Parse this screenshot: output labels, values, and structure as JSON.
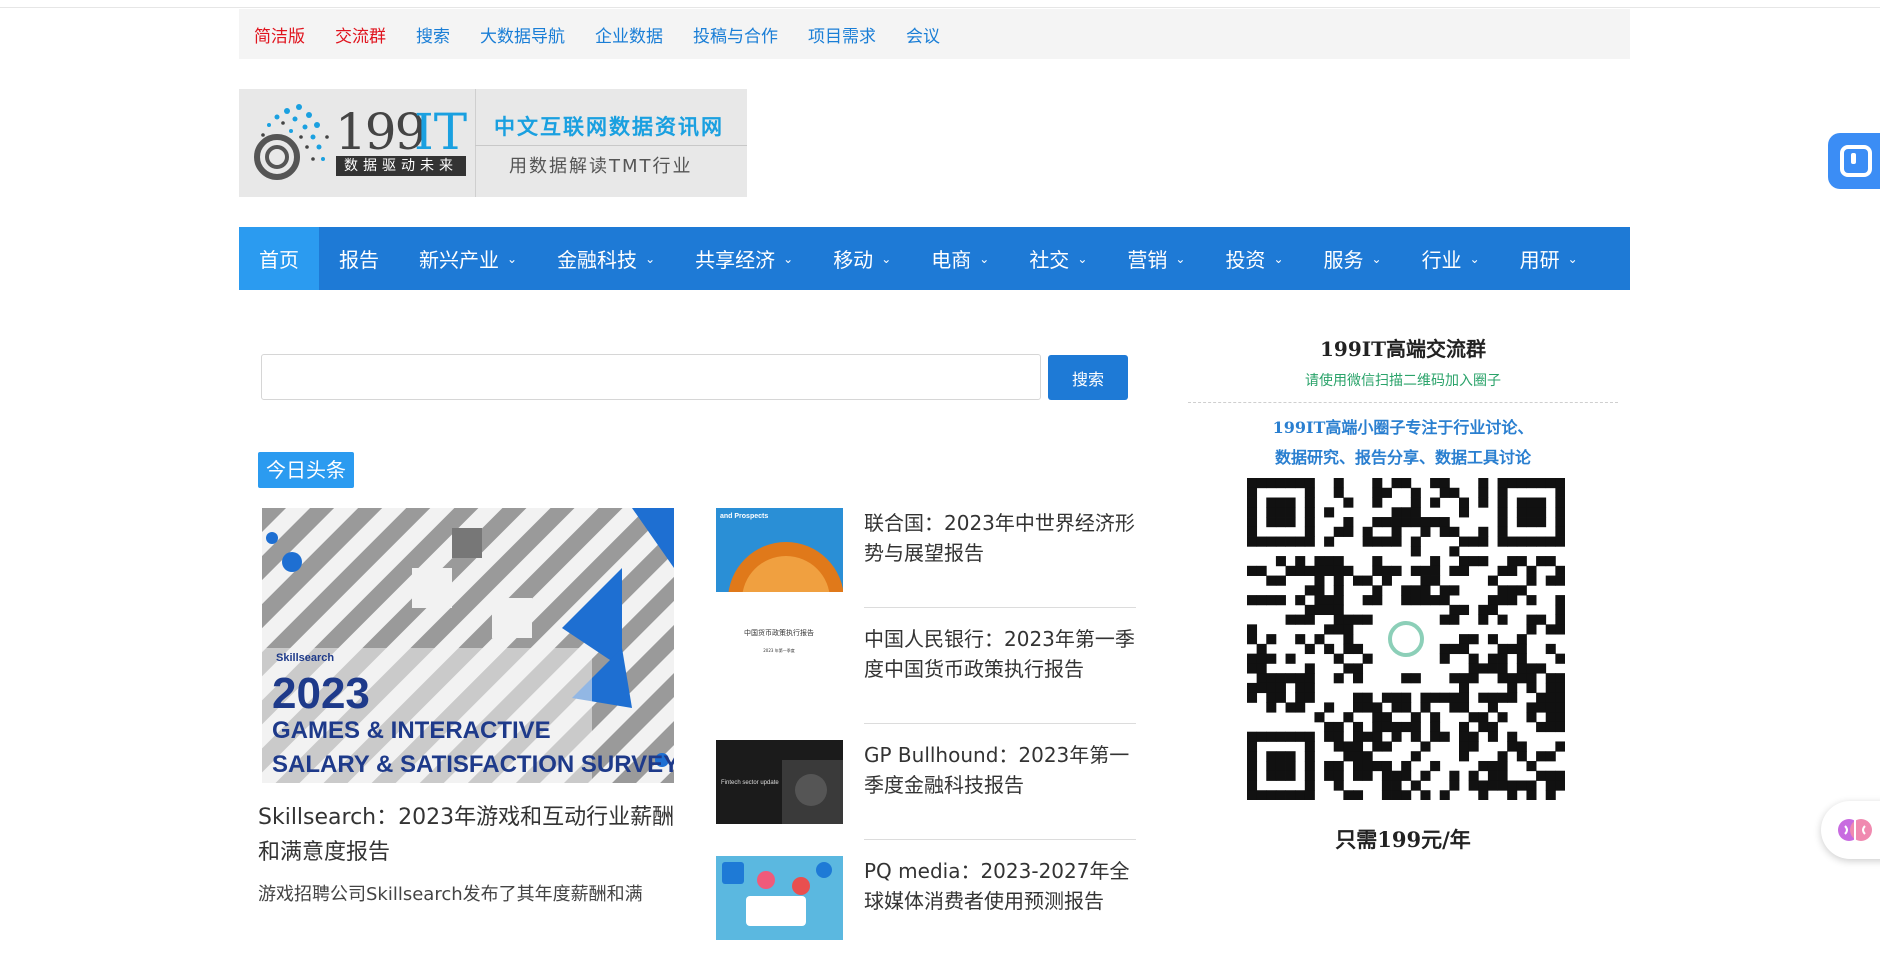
{
  "topbar": {
    "links": [
      {
        "label": "简洁版",
        "color": "#e0141e"
      },
      {
        "label": "交流群",
        "color": "#e0141e"
      },
      {
        "label": "搜索",
        "color": "#1a7ed6"
      },
      {
        "label": "大数据导航",
        "color": "#1a7ed6"
      },
      {
        "label": "企业数据",
        "color": "#1a7ed6"
      },
      {
        "label": "投稿与合作",
        "color": "#1a7ed6"
      },
      {
        "label": "项目需求",
        "color": "#1a7ed6"
      },
      {
        "label": "会议",
        "color": "#1a7ed6"
      }
    ]
  },
  "logo": {
    "number": "199",
    "it": "IT",
    "slogan": "数据驱动未来",
    "tagline": "中文互联网数据资讯网",
    "tagline2": "用数据解读TMT行业"
  },
  "nav": {
    "items": [
      {
        "label": "首页",
        "dropdown": false
      },
      {
        "label": "报告",
        "dropdown": false
      },
      {
        "label": "新兴产业",
        "dropdown": true
      },
      {
        "label": "金融科技",
        "dropdown": true
      },
      {
        "label": "共享经济",
        "dropdown": true
      },
      {
        "label": "移动",
        "dropdown": true
      },
      {
        "label": "电商",
        "dropdown": true
      },
      {
        "label": "社交",
        "dropdown": true
      },
      {
        "label": "营销",
        "dropdown": true
      },
      {
        "label": "投资",
        "dropdown": true
      },
      {
        "label": "服务",
        "dropdown": true
      },
      {
        "label": "行业",
        "dropdown": true
      },
      {
        "label": "用研",
        "dropdown": true
      }
    ],
    "active": "首页",
    "accent": "#1e7ad6"
  },
  "search": {
    "placeholder": "",
    "button": "搜索"
  },
  "headline": {
    "badge": "今日头条",
    "featured": {
      "image_text": {
        "brand": "Skillsearch",
        "year": "2023",
        "line1": "GAMES & INTERACTIVE",
        "line2": "SALARY & SATISFACTION SURVEY"
      },
      "title": "Skillsearch：2023年游戏和互动行业薪酬和满意度报告",
      "excerpt": "游戏招聘公司Skillsearch发布了其年度薪酬和满"
    },
    "news": [
      {
        "title": "联合国：2023年中世界经济形势与展望报告",
        "thumb_text": "and Prospects"
      },
      {
        "title": "中国人民银行：2023年第一季度中国货币政策执行报告",
        "thumb_text": "中国货币政策执行报告",
        "thumb_sub": "2023 年第一季度"
      },
      {
        "title": "GP Bullhound：2023年第一季度金融科技报告",
        "thumb_text": "Fintech sector update"
      },
      {
        "title": "PQ media：2023-2027年全球媒体消费者使用预测报告"
      }
    ]
  },
  "sidebar": {
    "qr_title": "199IT高端交流群",
    "qr_subtitle": "请使用微信扫描二维码加入圈子",
    "qr_line1": "199IT高端小圈子专注于行业讨论、",
    "qr_line2": "数据研究、报告分享、数据工具讨论",
    "price": "只需199元/年"
  }
}
